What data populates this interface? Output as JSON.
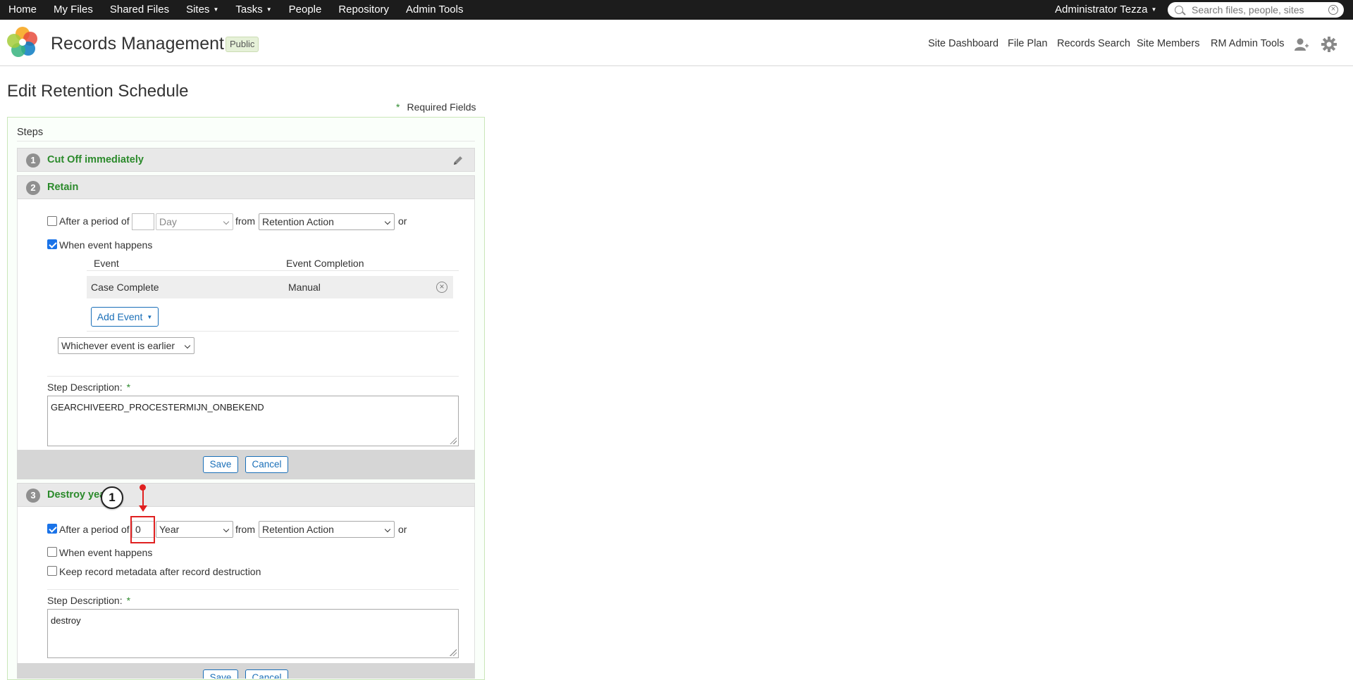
{
  "topbar": {
    "nav": [
      {
        "label": "Home",
        "dropdown": false
      },
      {
        "label": "My Files",
        "dropdown": false
      },
      {
        "label": "Shared Files",
        "dropdown": false
      },
      {
        "label": "Sites",
        "dropdown": true
      },
      {
        "label": "Tasks",
        "dropdown": true
      },
      {
        "label": "People",
        "dropdown": false
      },
      {
        "label": "Repository",
        "dropdown": false
      },
      {
        "label": "Admin Tools",
        "dropdown": false
      }
    ],
    "user": "Administrator Tezza",
    "search_placeholder": "Search files, people, sites"
  },
  "header": {
    "site_title": "Records Management",
    "visibility": "Public",
    "nav": [
      "Site Dashboard",
      "File Plan",
      "Records Search",
      "Site Members",
      "RM Admin Tools"
    ]
  },
  "page": {
    "title": "Edit Retention Schedule",
    "required_star": "*",
    "required_label": "Required Fields",
    "steps_label": "Steps"
  },
  "steps": [
    {
      "number": "1",
      "name": "Cut Off immediately"
    },
    {
      "number": "2",
      "name": "Retain",
      "after_period_label": "After a period of",
      "after_period_checked": false,
      "period_value": "",
      "period_unit": "Day",
      "from_label": "from",
      "from_value": "Retention Action",
      "or_label": "or",
      "when_event_label": "When event happens",
      "when_event_checked": true,
      "event_col_header": "Event",
      "completion_col_header": "Event Completion",
      "events": [
        {
          "event": "Case Complete",
          "completion": "Manual"
        }
      ],
      "add_event_label": "Add Event",
      "combine_option": "Whichever event is earlier",
      "description_label": "Step Description:",
      "description": "GEARCHIVEERD_PROCESTERMIJN_ONBEKEND",
      "save_label": "Save",
      "cancel_label": "Cancel"
    },
    {
      "number": "3",
      "name": "Destroy yea",
      "after_period_label": "After a period of",
      "after_period_checked": true,
      "period_value": "0",
      "period_unit": "Year",
      "from_label": "from",
      "from_value": "Retention Action",
      "or_label": "or",
      "when_event_label": "When event happens",
      "when_event_checked": false,
      "keep_metadata_label": "Keep record metadata after record destruction",
      "keep_metadata_checked": false,
      "description_label": "Step Description:",
      "description": "destroy",
      "save_label": "Save",
      "cancel_label": "Cancel"
    }
  ],
  "annotation": {
    "label": "1",
    "color": "#e02020"
  },
  "colors": {
    "accent_green": "#2b8a2b",
    "link_blue": "#1a6fb8",
    "topbar": "#1c1c1c"
  }
}
